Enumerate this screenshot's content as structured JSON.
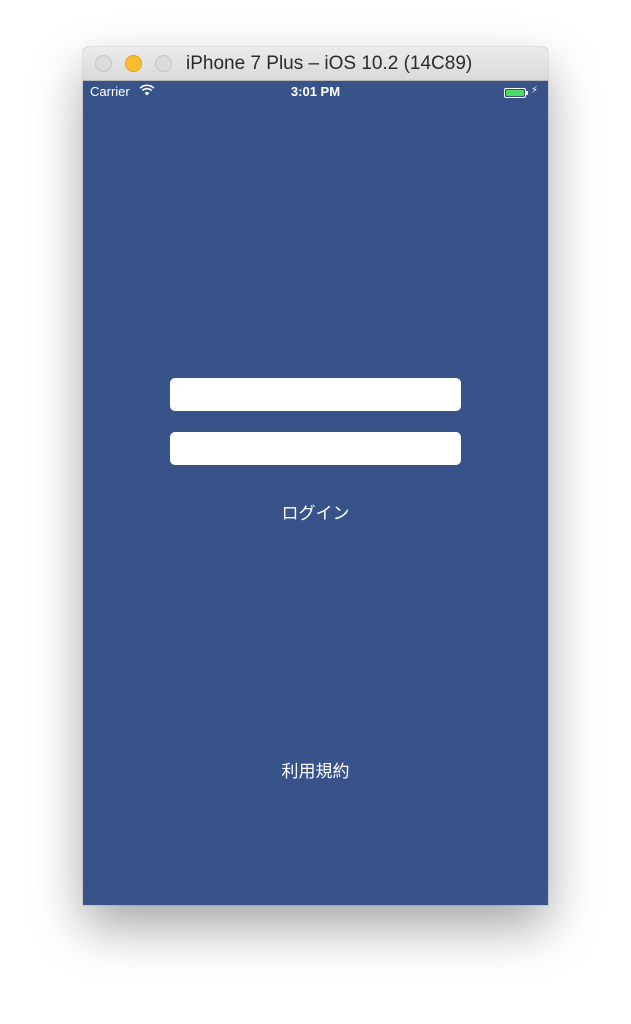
{
  "window": {
    "title": "iPhone 7 Plus – iOS 10.2 (14C89)",
    "background_color": "#38538a"
  },
  "statusbar": {
    "carrier": "Carrier",
    "wifi_icon": "wifi-icon",
    "time": "3:01 PM",
    "battery_icon": "battery-icon",
    "battery_color": "#4cd964",
    "battery_level": 1.0
  },
  "form": {
    "username": {
      "value": "",
      "placeholder": ""
    },
    "password": {
      "value": "",
      "placeholder": ""
    },
    "login_label": "ログイン"
  },
  "footer": {
    "terms_label": "利用規約"
  }
}
